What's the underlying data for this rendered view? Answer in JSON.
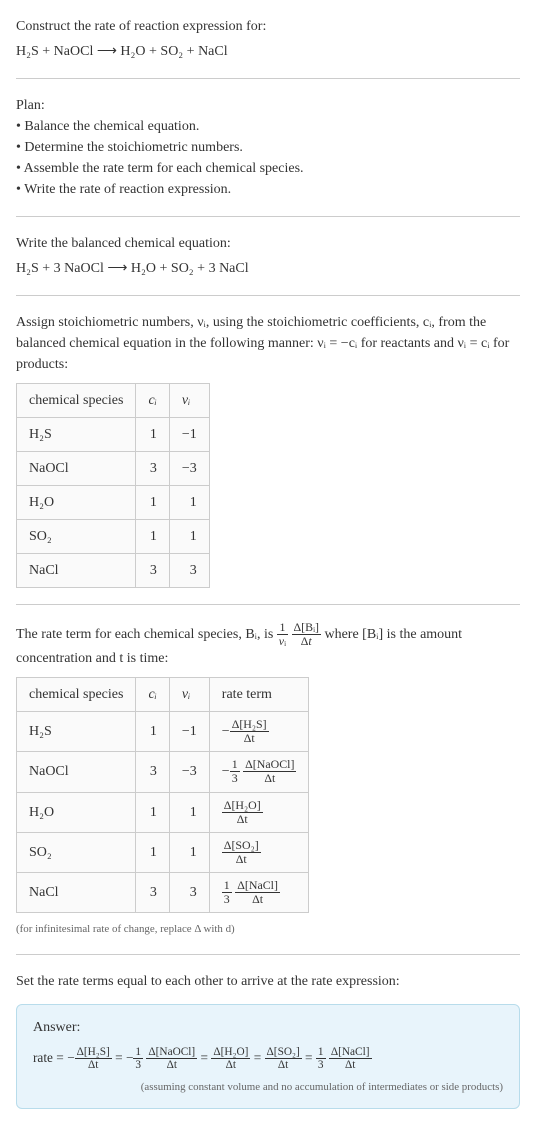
{
  "header": {
    "prompt": "Construct the rate of reaction expression for:",
    "equation": "H₂S + NaOCl ⟶ H₂O + SO₂ + NaCl"
  },
  "plan": {
    "title": "Plan:",
    "items": [
      "Balance the chemical equation.",
      "Determine the stoichiometric numbers.",
      "Assemble the rate term for each chemical species.",
      "Write the rate of reaction expression."
    ]
  },
  "balanced": {
    "intro": "Write the balanced chemical equation:",
    "equation": "H₂S + 3 NaOCl ⟶ H₂O + SO₂ + 3 NaCl"
  },
  "stoich": {
    "intro": "Assign stoichiometric numbers, νᵢ, using the stoichiometric coefficients, cᵢ, from the balanced chemical equation in the following manner: νᵢ = −cᵢ for reactants and νᵢ = cᵢ for products:",
    "headers": [
      "chemical species",
      "cᵢ",
      "νᵢ"
    ],
    "rows": [
      {
        "species": "H₂S",
        "c": "1",
        "v": "−1"
      },
      {
        "species": "NaOCl",
        "c": "3",
        "v": "−3"
      },
      {
        "species": "H₂O",
        "c": "1",
        "v": "1"
      },
      {
        "species": "SO₂",
        "c": "1",
        "v": "1"
      },
      {
        "species": "NaCl",
        "c": "3",
        "v": "3"
      }
    ]
  },
  "rateterm": {
    "intro_part1": "The rate term for each chemical species, Bᵢ, is ",
    "intro_part2": " where [Bᵢ] is the amount concentration and t is time:",
    "headers": [
      "chemical species",
      "cᵢ",
      "νᵢ",
      "rate term"
    ],
    "rows": [
      {
        "species": "H₂S",
        "c": "1",
        "v": "−1",
        "prefix": "−",
        "coef": "",
        "num": "Δ[H₂S]",
        "den": "Δt"
      },
      {
        "species": "NaOCl",
        "c": "3",
        "v": "−3",
        "prefix": "−",
        "coef_num": "1",
        "coef_den": "3",
        "num": "Δ[NaOCl]",
        "den": "Δt"
      },
      {
        "species": "H₂O",
        "c": "1",
        "v": "1",
        "prefix": "",
        "coef": "",
        "num": "Δ[H₂O]",
        "den": "Δt"
      },
      {
        "species": "SO₂",
        "c": "1",
        "v": "1",
        "prefix": "",
        "coef": "",
        "num": "Δ[SO₂]",
        "den": "Δt"
      },
      {
        "species": "NaCl",
        "c": "3",
        "v": "3",
        "prefix": "",
        "coef_num": "1",
        "coef_den": "3",
        "num": "Δ[NaCl]",
        "den": "Δt"
      }
    ],
    "note": "(for infinitesimal rate of change, replace Δ with d)"
  },
  "final": {
    "intro": "Set the rate terms equal to each other to arrive at the rate expression:",
    "answer_label": "Answer:",
    "rate_prefix": "rate = ",
    "terms": [
      {
        "sign": "−",
        "coef_num": "",
        "coef_den": "",
        "num": "Δ[H₂S]",
        "den": "Δt"
      },
      {
        "sign": "−",
        "coef_num": "1",
        "coef_den": "3",
        "num": "Δ[NaOCl]",
        "den": "Δt"
      },
      {
        "sign": "",
        "coef_num": "",
        "coef_den": "",
        "num": "Δ[H₂O]",
        "den": "Δt"
      },
      {
        "sign": "",
        "coef_num": "",
        "coef_den": "",
        "num": "Δ[SO₂]",
        "den": "Δt"
      },
      {
        "sign": "",
        "coef_num": "1",
        "coef_den": "3",
        "num": "Δ[NaCl]",
        "den": "Δt"
      }
    ],
    "note": "(assuming constant volume and no accumulation of intermediates or side products)"
  }
}
